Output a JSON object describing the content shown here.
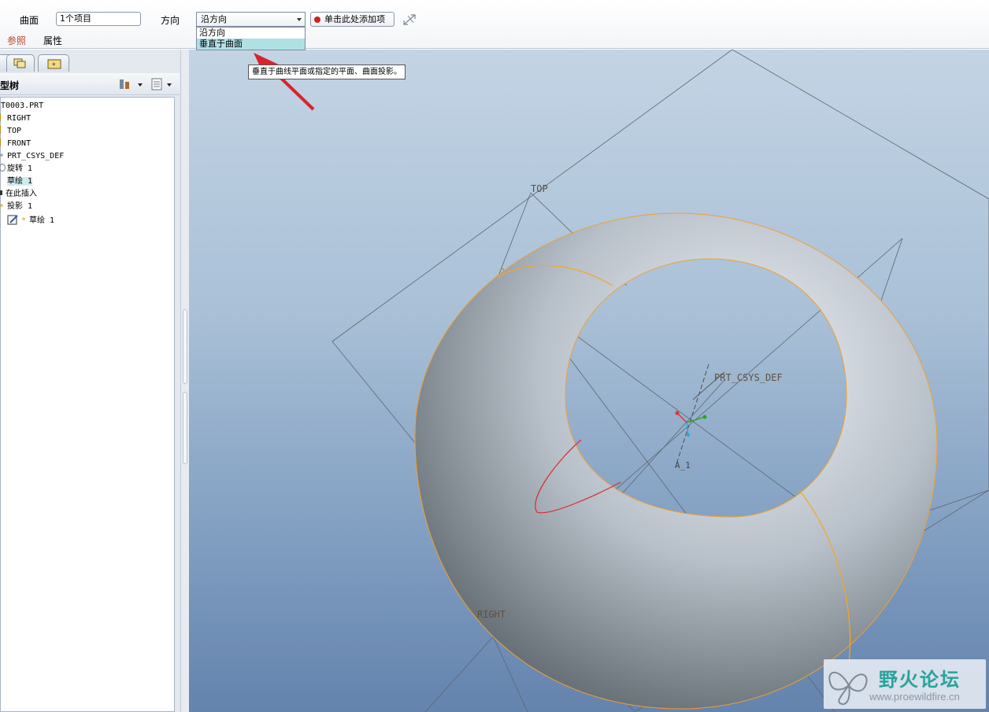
{
  "dashboard": {
    "surface_label": "曲面",
    "surface_value": "1个项目",
    "direction_label": "方向",
    "direction_value": "沿方向",
    "direction_options": [
      "沿方向",
      "垂直于曲面"
    ],
    "add_item_label": "单击此处添加项",
    "tab_references": "参照",
    "tab_properties": "属性"
  },
  "tooltip": "垂直于曲线平面或指定的平面、曲面投影。",
  "tree": {
    "header": "型树",
    "items": [
      {
        "label": "T0003.PRT"
      },
      {
        "label": "RIGHT"
      },
      {
        "label": "TOP"
      },
      {
        "label": "FRONT"
      },
      {
        "label": "PRT_CSYS_DEF"
      },
      {
        "label": "旋转 1"
      },
      {
        "label": "草绘 1"
      },
      {
        "label": "在此插入"
      },
      {
        "label": "投影 1"
      },
      {
        "label": "草绘 1"
      }
    ]
  },
  "viewport": {
    "plane_top": "TOP",
    "plane_right": "RIGHT",
    "csys": "PRT_CSYS_DEF",
    "axis": "A_1"
  },
  "watermark": {
    "title": "野火论坛",
    "url": "www.proewildfire.cn"
  },
  "colors": {
    "accent_orange": "#f5a623",
    "sketch_red": "#e0282a",
    "arrow_red": "#d9232a",
    "watermark_teal": "#2aa29b"
  }
}
